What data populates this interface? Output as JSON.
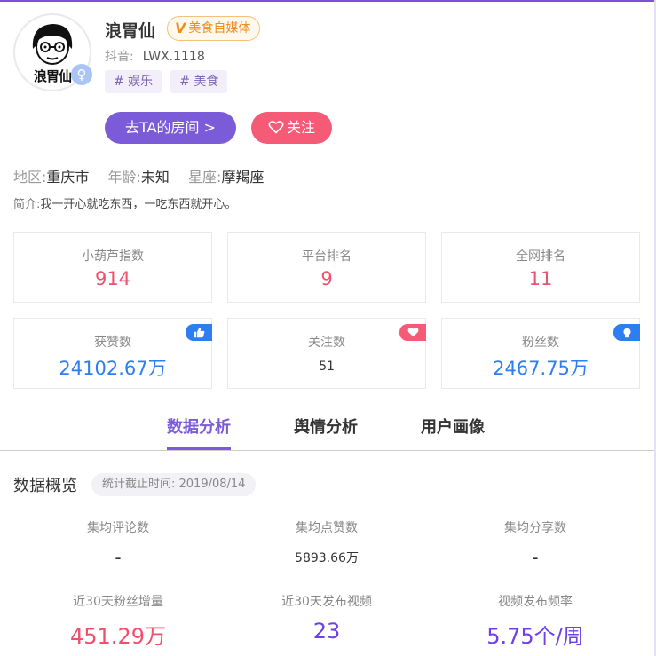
{
  "profile": {
    "name": "浪胃仙",
    "badge": "美食自媒体",
    "badge_mark": "V",
    "avatar_text": "浪胃仙",
    "gender_symbol": "♀",
    "douyin_label": "抖音:",
    "douyin_id": "LWX.1118",
    "tags": [
      "# 娱乐",
      "# 美食"
    ]
  },
  "actions": {
    "room_label": "去TA的房间 >",
    "follow_label": "关注"
  },
  "info": {
    "region_label": "地区:",
    "region": "重庆市",
    "age_label": "年龄:",
    "age": "未知",
    "zodiac_label": "星座:",
    "zodiac": "摩羯座",
    "intro_label": "简介:",
    "intro": "我一开心就吃东西，一吃东西就开心。"
  },
  "cards": [
    {
      "label": "小葫芦指数",
      "value": "914"
    },
    {
      "label": "平台排名",
      "value": "9"
    },
    {
      "label": "全网排名",
      "value": "11"
    },
    {
      "label": "获赞数",
      "value": "24102.67万",
      "icon": "thumbs-up-icon"
    },
    {
      "label": "关注数",
      "value": "51",
      "icon": "heart-icon"
    },
    {
      "label": "粉丝数",
      "value": "2467.75万",
      "icon": "person-icon"
    }
  ],
  "tabs": [
    "数据分析",
    "舆情分析",
    "用户画像"
  ],
  "overview": {
    "title": "数据概览",
    "date": "统计截止时间: 2019/08/14",
    "stats": [
      {
        "label": "集均评论数",
        "value": "-"
      },
      {
        "label": "集均点赞数",
        "value": "5893.66万"
      },
      {
        "label": "集均分享数",
        "value": "-"
      },
      {
        "label": "近30天粉丝增量",
        "value": "451.29万"
      },
      {
        "label": "近30天发布视频",
        "value": "23"
      },
      {
        "label": "视频发布频率",
        "value": "5.75个/周"
      }
    ]
  },
  "colors": {
    "accent": "#7b5bd8",
    "red": "#f0506e",
    "blue": "#2d7ef0",
    "purple": "#6f3fe8"
  }
}
